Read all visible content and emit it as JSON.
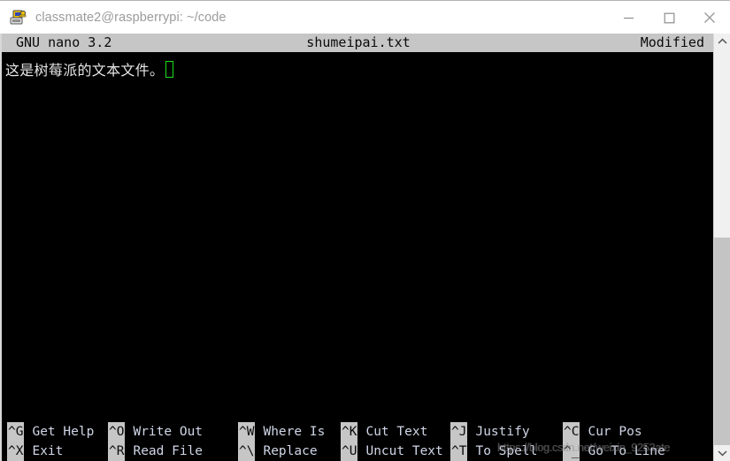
{
  "window": {
    "title": "classmate2@raspberrypi: ~/code",
    "icon": "putty-terminal-icon",
    "controls": {
      "minimize": "minimize-icon",
      "maximize": "maximize-icon",
      "close": "close-icon"
    }
  },
  "nano": {
    "header": {
      "version": "GNU nano 3.2",
      "filename": "shumeipai.txt",
      "state": "Modified"
    },
    "editor": {
      "line1": "这是树莓派的文本文件。",
      "cursor": "block-cursor"
    },
    "shortcuts_row1": [
      {
        "key": "^G",
        "label": "Get Help"
      },
      {
        "key": "^O",
        "label": "Write Out"
      },
      {
        "key": "^W",
        "label": "Where Is"
      },
      {
        "key": "^K",
        "label": "Cut Text"
      },
      {
        "key": "^J",
        "label": "Justify"
      },
      {
        "key": "^C",
        "label": "Cur Pos"
      }
    ],
    "shortcuts_row2": [
      {
        "key": "^X",
        "label": "Exit"
      },
      {
        "key": "^R",
        "label": "Read File"
      },
      {
        "key": "^\\",
        "label": "Replace"
      },
      {
        "key": "^U",
        "label": "Uncut Text"
      },
      {
        "key": "^T",
        "label": "To Spell"
      },
      {
        "key": "^_",
        "label": "Go To Line"
      }
    ]
  },
  "watermark": {
    "text": "https://blog.csdn.net/weixin_9253ate"
  },
  "scrollbar": {
    "up_arrow": "chevron-up-icon",
    "down_arrow": "chevron-down-icon"
  },
  "colors": {
    "terminal_bg": "#000000",
    "header_bg": "#c6c6c6",
    "cursor_green": "#19e019",
    "label_text": "#cfd6e6"
  }
}
